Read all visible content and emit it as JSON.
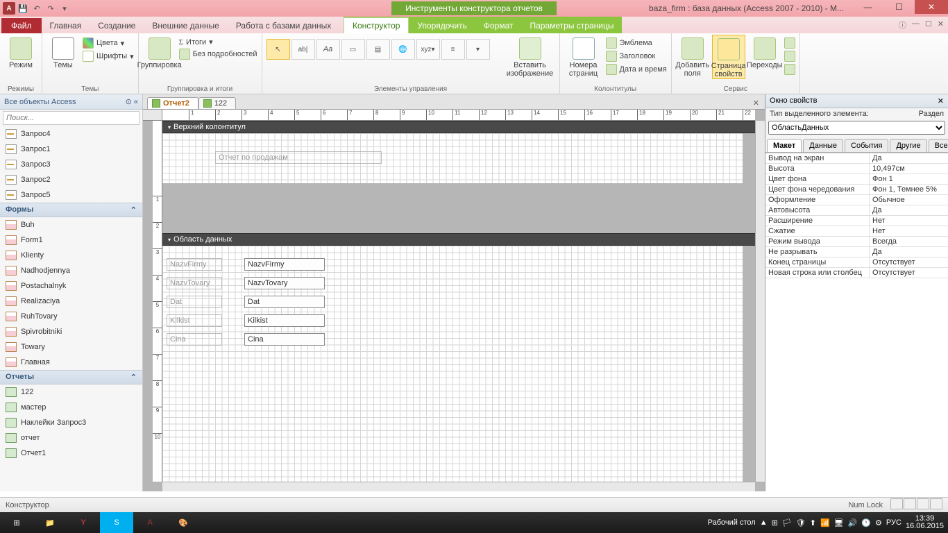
{
  "titlebar": {
    "context_title": "Инструменты конструктора отчетов",
    "window_title": "baza_firm : база данных (Access 2007 - 2010) - M..."
  },
  "ribbon": {
    "file": "Файл",
    "tabs": [
      "Главная",
      "Создание",
      "Внешние данные",
      "Работа с базами данных"
    ],
    "context_tabs": [
      "Конструктор",
      "Упорядочить",
      "Формат",
      "Параметры страницы"
    ],
    "groups": {
      "modes": {
        "label": "Режимы",
        "mode": "Режим"
      },
      "themes": {
        "label": "Темы",
        "themes": "Темы",
        "colors": "Цвета",
        "fonts": "Шрифты"
      },
      "grouping": {
        "label": "Группировка и итоги",
        "group": "Группировка",
        "totals": "Итоги",
        "nodetails": "Без подробностей"
      },
      "controls": {
        "label": "Элементы управления",
        "insert_img": "Вставить изображение"
      },
      "header": {
        "label": "Колонтитулы",
        "page_no": "Номера страниц",
        "emblem": "Эмблема",
        "title": "Заголовок",
        "datetime": "Дата и время"
      },
      "service": {
        "label": "Сервис",
        "add_fields": "Добавить поля",
        "prop_page": "Страница свойств",
        "tab_order": "Переходы"
      }
    }
  },
  "nav": {
    "title": "Все объекты Access",
    "search_placeholder": "Поиск...",
    "queries": [
      "Запрос4",
      "Запрос1",
      "Запрос3",
      "Запрос2",
      "Запрос5"
    ],
    "forms_label": "Формы",
    "forms": [
      "Buh",
      "Form1",
      "Klienty",
      "Nadhodjennya",
      "Postachalnyk",
      "Realizaciya",
      "RuhTovary",
      "Spivrobitniki",
      "Towary",
      "Главная"
    ],
    "reports_label": "Отчеты",
    "reports": [
      "122",
      "мастер",
      "Наклейки Запрос3",
      "отчет",
      "Отчет1"
    ]
  },
  "doc": {
    "tabs": [
      {
        "name": "Отчет2",
        "active": true
      },
      {
        "name": "122",
        "active": false
      }
    ],
    "section_header": "Верхний колонтитул",
    "section_detail": "Область данных",
    "title_label": "Отчет по продажам",
    "fields": [
      {
        "label": "NazvFirmy",
        "field": "NazvFirmy"
      },
      {
        "label": "NazvTovary",
        "field": "NazvTovary"
      },
      {
        "label": "Dat",
        "field": "Dat"
      },
      {
        "label": "Kilkist",
        "field": "Kilkist"
      },
      {
        "label": "Cina",
        "field": "Cina"
      }
    ]
  },
  "props": {
    "title": "Окно свойств",
    "subtitle": "Тип выделенного элемента:",
    "subtitle_val": "Раздел",
    "selector": "ОбластьДанных",
    "tabs": [
      "Макет",
      "Данные",
      "События",
      "Другие",
      "Все"
    ],
    "rows": [
      {
        "k": "Вывод на экран",
        "v": "Да"
      },
      {
        "k": "Высота",
        "v": "10,497см"
      },
      {
        "k": "Цвет фона",
        "v": "Фон 1"
      },
      {
        "k": "Цвет фона чередования",
        "v": "Фон 1, Темнее 5%"
      },
      {
        "k": "Оформление",
        "v": "Обычное"
      },
      {
        "k": "Автовысота",
        "v": "Да"
      },
      {
        "k": "Расширение",
        "v": "Нет"
      },
      {
        "k": "Сжатие",
        "v": "Нет"
      },
      {
        "k": "Режим вывода",
        "v": "Всегда"
      },
      {
        "k": "Не разрывать",
        "v": "Да"
      },
      {
        "k": "Конец страницы",
        "v": "Отсутствует"
      },
      {
        "k": "Новая строка или столбец",
        "v": "Отсутствует"
      }
    ]
  },
  "status": {
    "left": "Конструктор",
    "numlock": "Num Lock"
  },
  "taskbar": {
    "desktop": "Рабочий стол",
    "lang": "РУС",
    "time": "13:39",
    "date": "16.06.2015"
  }
}
